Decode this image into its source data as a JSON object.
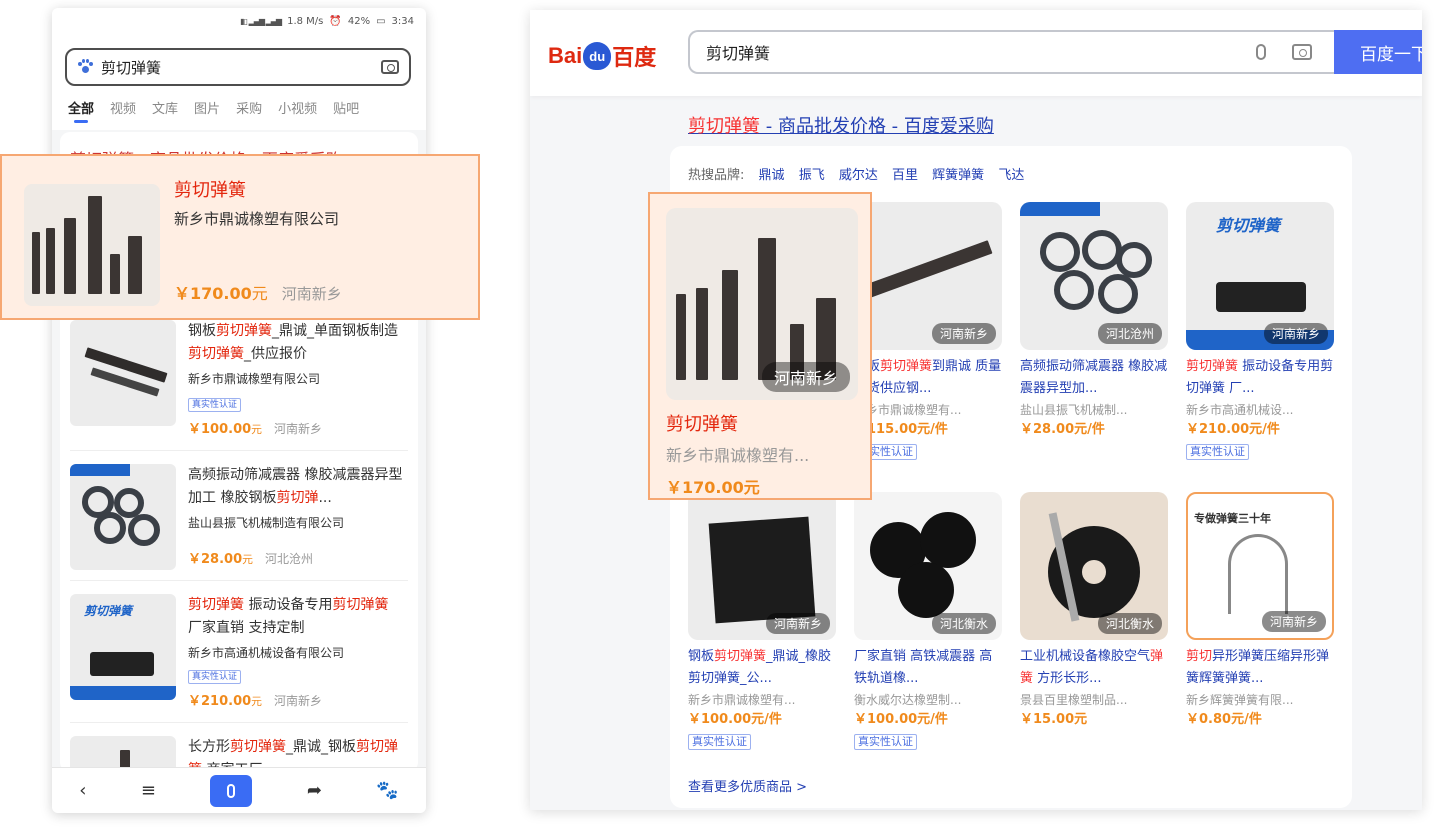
{
  "phone": {
    "status": {
      "net": "1.8 M/s",
      "battery": "42%",
      "time": "3:34"
    },
    "search_query": "剪切弹簧",
    "tabs": [
      "全部",
      "视频",
      "文库",
      "图片",
      "采购",
      "小视频",
      "贴吧"
    ],
    "card_title": "剪切弹簧 - 商品批发价格 - 百度爱采购",
    "items": [
      {
        "title_pre": "钢板",
        "title_hl1": "剪切弹簧",
        "title_mid": "_鼎诚_单面钢板制造",
        "title_hl2": "剪切弹簧",
        "title_post": "_供应报价",
        "company": "新乡市鼎诚橡塑有限公司",
        "badge": "真实性认证",
        "price": "￥100.00",
        "unit": "元",
        "location": "河南新乡"
      },
      {
        "title_pre": "高频振动筛减震器 橡胶减震器异型加工 橡胶钢板",
        "title_hl1": "剪切弹",
        "title_mid": "...",
        "title_hl2": "",
        "title_post": "",
        "company": "盐山县振飞机械制造有限公司",
        "badge": "",
        "price": "￥28.00",
        "unit": "元",
        "location": "河北沧州"
      },
      {
        "title_pre": "",
        "title_hl1": "剪切弹簧",
        "title_mid": " 振动设备专用",
        "title_hl2": "剪切弹簧",
        "title_post": " 厂家直销 支持定制",
        "company": "新乡市高通机械设备有限公司",
        "badge": "真实性认证",
        "price": "￥210.00",
        "unit": "元",
        "location": "河南新乡"
      },
      {
        "title_pre": "长方形",
        "title_hl1": "剪切弹簧",
        "title_mid": "_鼎诚_钢板",
        "title_hl2": "剪切弹簧",
        "title_post": " 商家工厂",
        "company": "",
        "badge": "",
        "price": "",
        "unit": "",
        "location": ""
      }
    ]
  },
  "popup_left": {
    "title": "剪切弹簧",
    "company": "新乡市鼎诚橡塑有限公司",
    "price": "￥170.00",
    "unit": "元",
    "location": "河南新乡"
  },
  "desktop": {
    "logo": {
      "a": "Bai",
      "paw": "du",
      "b": "百度"
    },
    "search_query": "剪切弹簧",
    "search_button": "百度一下",
    "result_title_hl": "剪切弹簧",
    "result_title_rest": " - 商品批发价格 - 百度爱采购",
    "hot_label": "热搜品牌:",
    "hot_brands": [
      "鼎诚",
      "振飞",
      "威尔达",
      "百里",
      "辉簧弹簧",
      "飞达"
    ],
    "grid": [
      {
        "tag": "河南新乡",
        "t_pre": "钢板",
        "t_hl": "剪切弹簧",
        "t_post": "到鼎诚 质量现货供应钢...",
        "company": "新乡市鼎诚橡塑有...",
        "price": "￥115.00元/件",
        "verified": "真实性认证"
      },
      {
        "tag": "河北沧州",
        "t_pre": "高频振动筛减震器 橡胶减震器异型加...",
        "t_hl": "",
        "t_post": "",
        "company": "盐山县振飞机械制...",
        "price": "￥28.00元/件",
        "verified": ""
      },
      {
        "tag": "河南新乡",
        "t_pre": "",
        "t_hl": "剪切弹簧",
        "t_post": " 振动设备专用剪切弹簧 厂...",
        "company": "新乡市高通机械设...",
        "price": "￥210.00元/件",
        "verified": "真实性认证"
      },
      {
        "tag": "河南新乡",
        "t_pre": "钢板",
        "t_hl": "剪切弹簧",
        "t_post": "_鼎诚_橡胶剪切弹簧_公...",
        "company": "新乡市鼎诚橡塑有...",
        "price": "￥100.00元/件",
        "verified": "真实性认证"
      },
      {
        "tag": "河北衡水",
        "t_pre": "厂家直销 高铁减震器 高铁轨道橡...",
        "t_hl": "",
        "t_post": "",
        "company": "衡水威尔达橡塑制...",
        "price": "￥100.00元/件",
        "verified": "真实性认证"
      },
      {
        "tag": "河北衡水",
        "t_pre": "工业机械设备橡胶空气",
        "t_hl": "弹簧",
        "t_post": " 方形长形...",
        "company": "景县百里橡塑制品...",
        "price": "￥15.00元",
        "verified": ""
      },
      {
        "tag": "河南新乡",
        "t_pre": "",
        "t_hl": "剪切",
        "t_post": "异形弹簧压缩异形弹簧辉簧弹簧...",
        "company": "新乡辉簧弹簧有限...",
        "price": "￥0.80元/件",
        "verified": ""
      }
    ],
    "more_link": "查看更多优质商品 >"
  },
  "popup_right": {
    "tag": "河南新乡",
    "title": "剪切弹簧",
    "company": "新乡市鼎诚橡塑有...",
    "price": "￥170.00元"
  },
  "colors": {
    "accent": "#4e6ef2",
    "highlight_red": "#e3260d",
    "price_orange": "#f08a1c",
    "popup_bg": "#ffeee3",
    "popup_border": "#f6a772"
  }
}
